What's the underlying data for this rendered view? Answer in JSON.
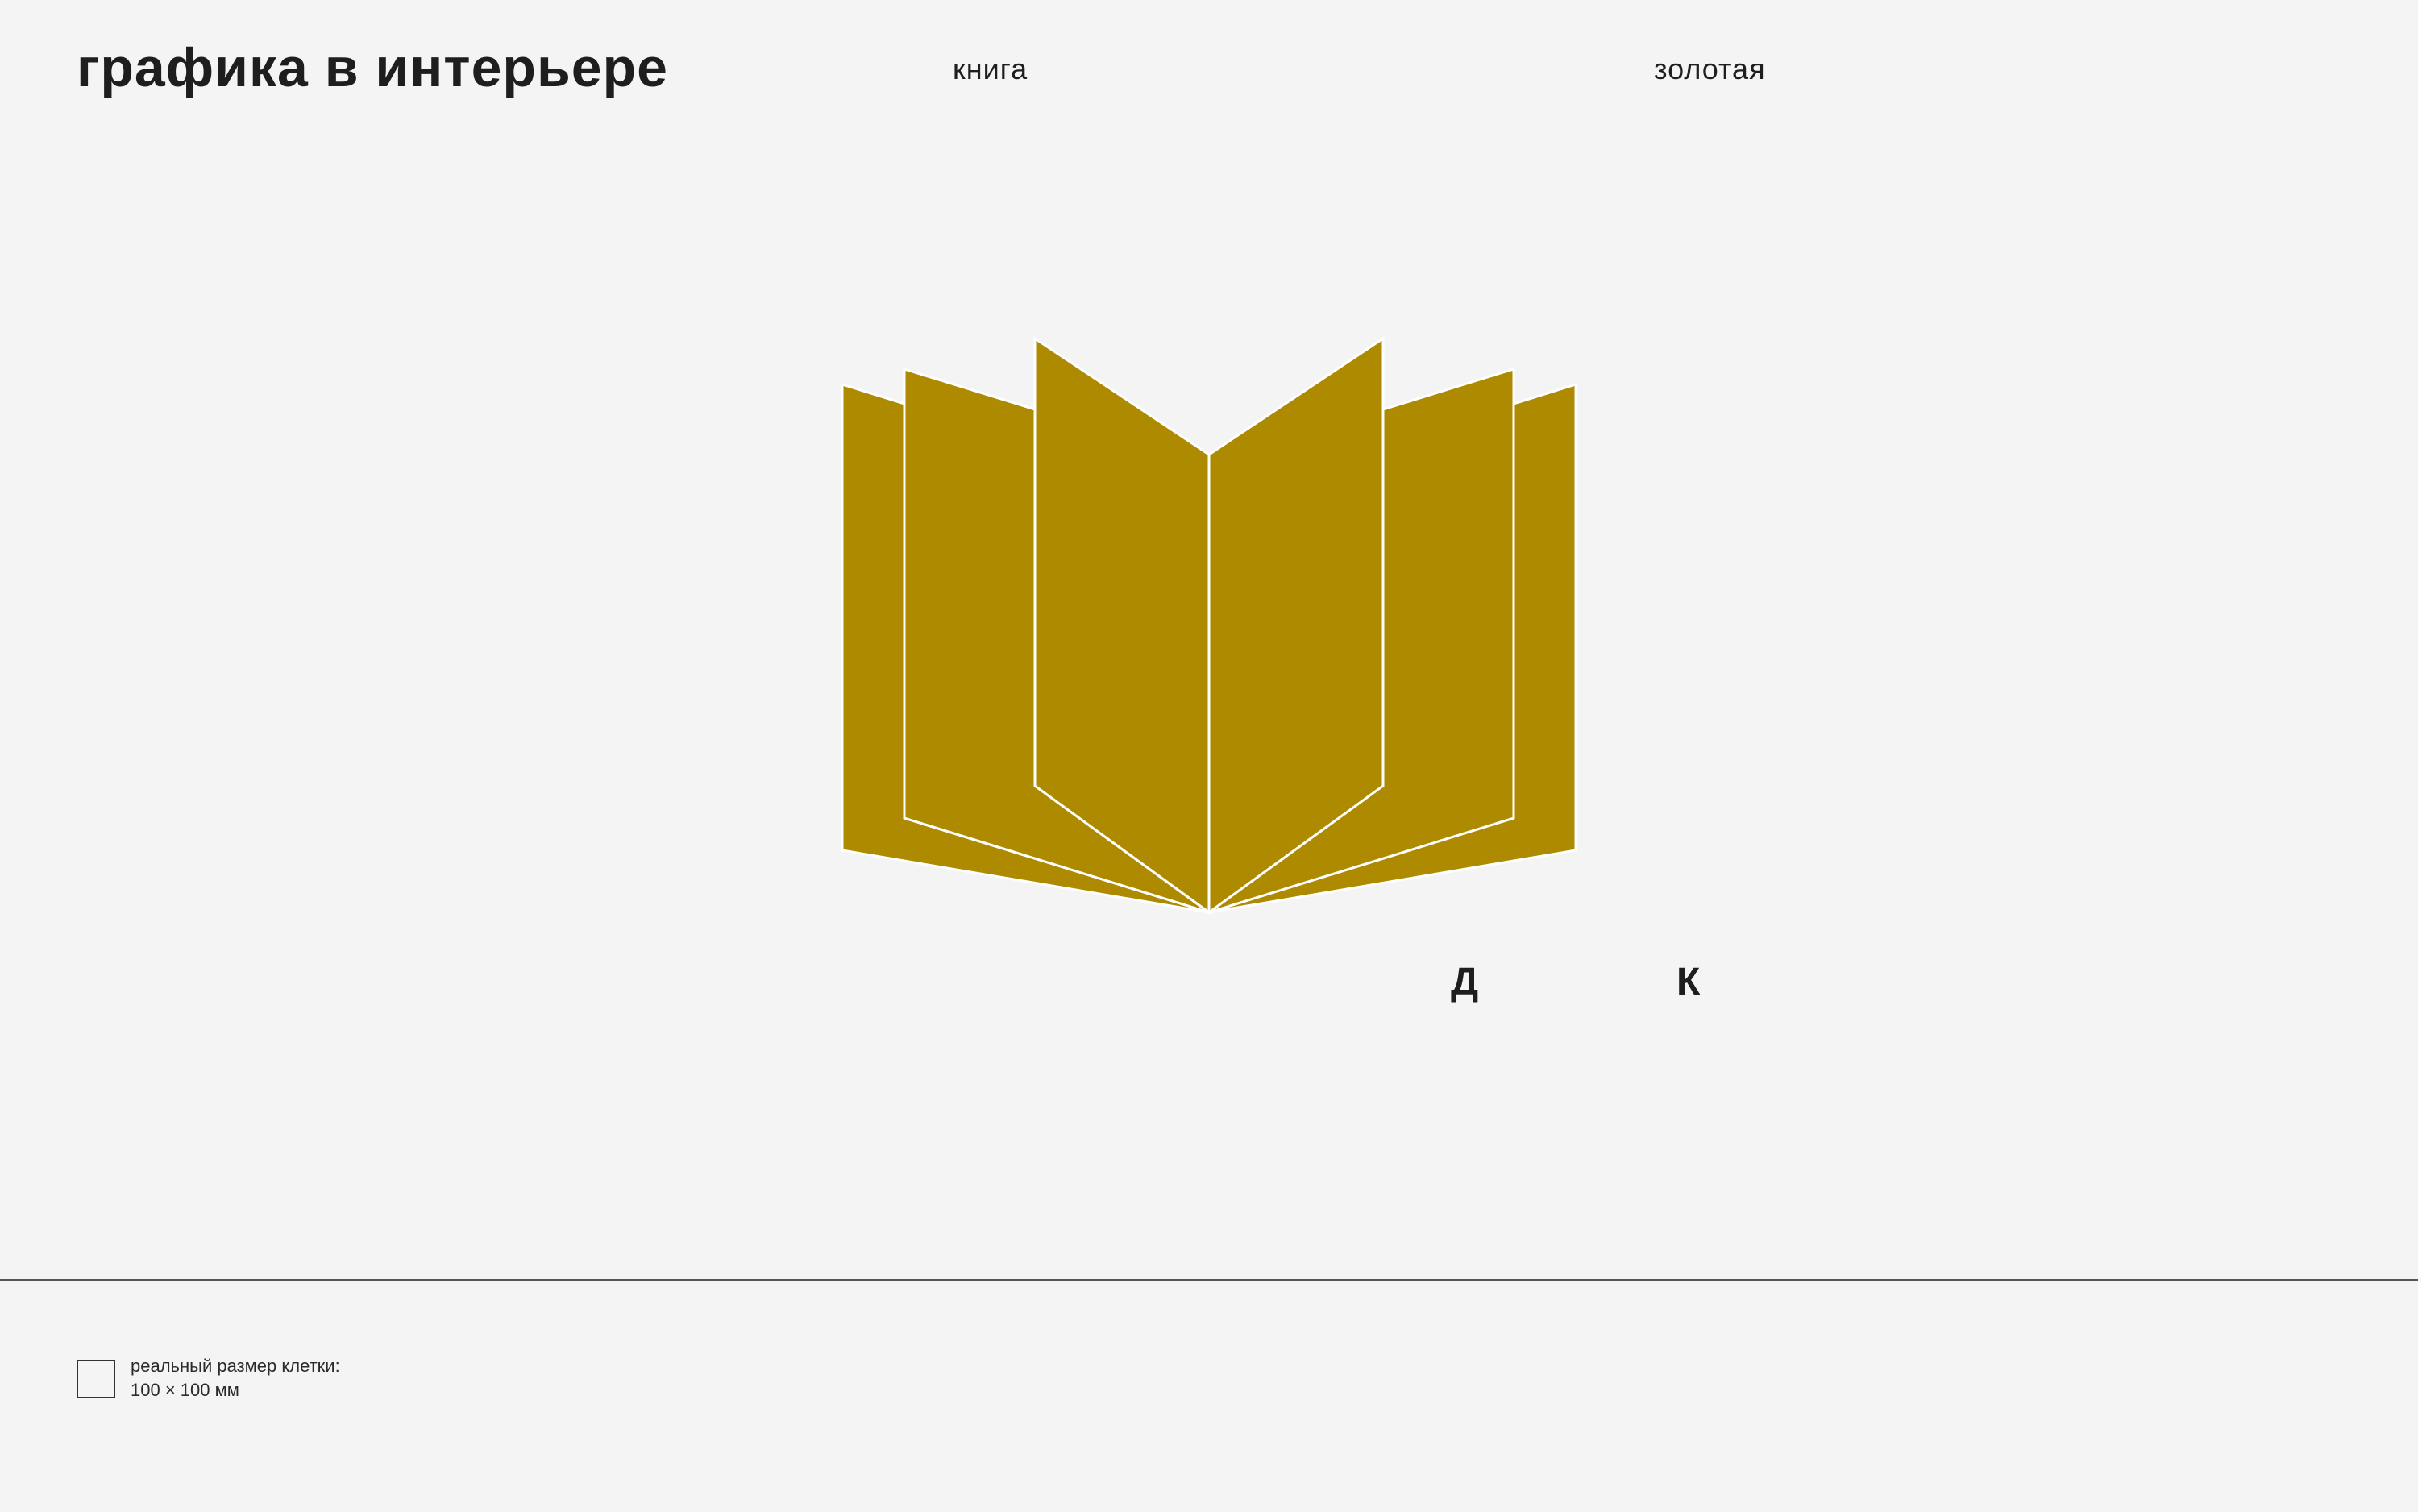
{
  "header": {
    "title": "графика в интерьере",
    "label_object": "книга",
    "label_color": "золотая"
  },
  "illustration": {
    "subject": "open-book-icon",
    "fill_color": "#ae8a00",
    "line_color": "#ffffff"
  },
  "initials": [
    "Д",
    "К"
  ],
  "footer": {
    "cell_note_line1": "реальный размер клетки:",
    "cell_note_line2": "100 × 100 мм"
  },
  "colors": {
    "background": "#f4f4f4",
    "text": "#1e1e1e",
    "accent_gold": "#ae8a00"
  }
}
